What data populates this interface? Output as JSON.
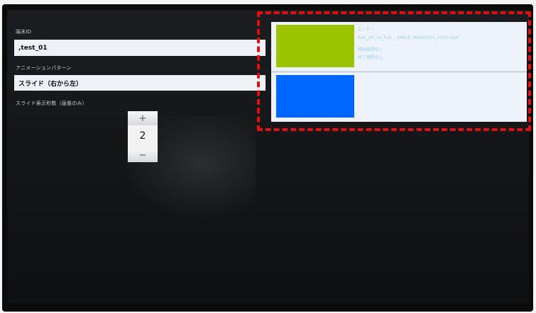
{
  "form": {
    "terminal_id_label": "端末ID",
    "terminal_id_value": ",test_01",
    "animation_label": "アニメーションパターン",
    "animation_value": "スライド（右から左）",
    "slide_seconds_label": "スライド表示秒数（画像のみ）",
    "slide_seconds_value": "2",
    "stepper_plus": "+",
    "stepper_minus": "−"
  },
  "media_list": {
    "items": [
      {
        "type_label": "ムービー",
        "filename": "Kari_ohi_vs_FLR_-_SPACE_INVADERS_2003.mp4",
        "line1": "開始期間なし",
        "line2": "終了期間なし",
        "thumb_color": "#9ec400"
      },
      {
        "type_label": "",
        "filename": "",
        "line1": "",
        "line2": "",
        "thumb_color": "#0066ff"
      }
    ]
  },
  "colors": {
    "highlight": "#e10f0f",
    "field_bg": "#eef1f6"
  }
}
